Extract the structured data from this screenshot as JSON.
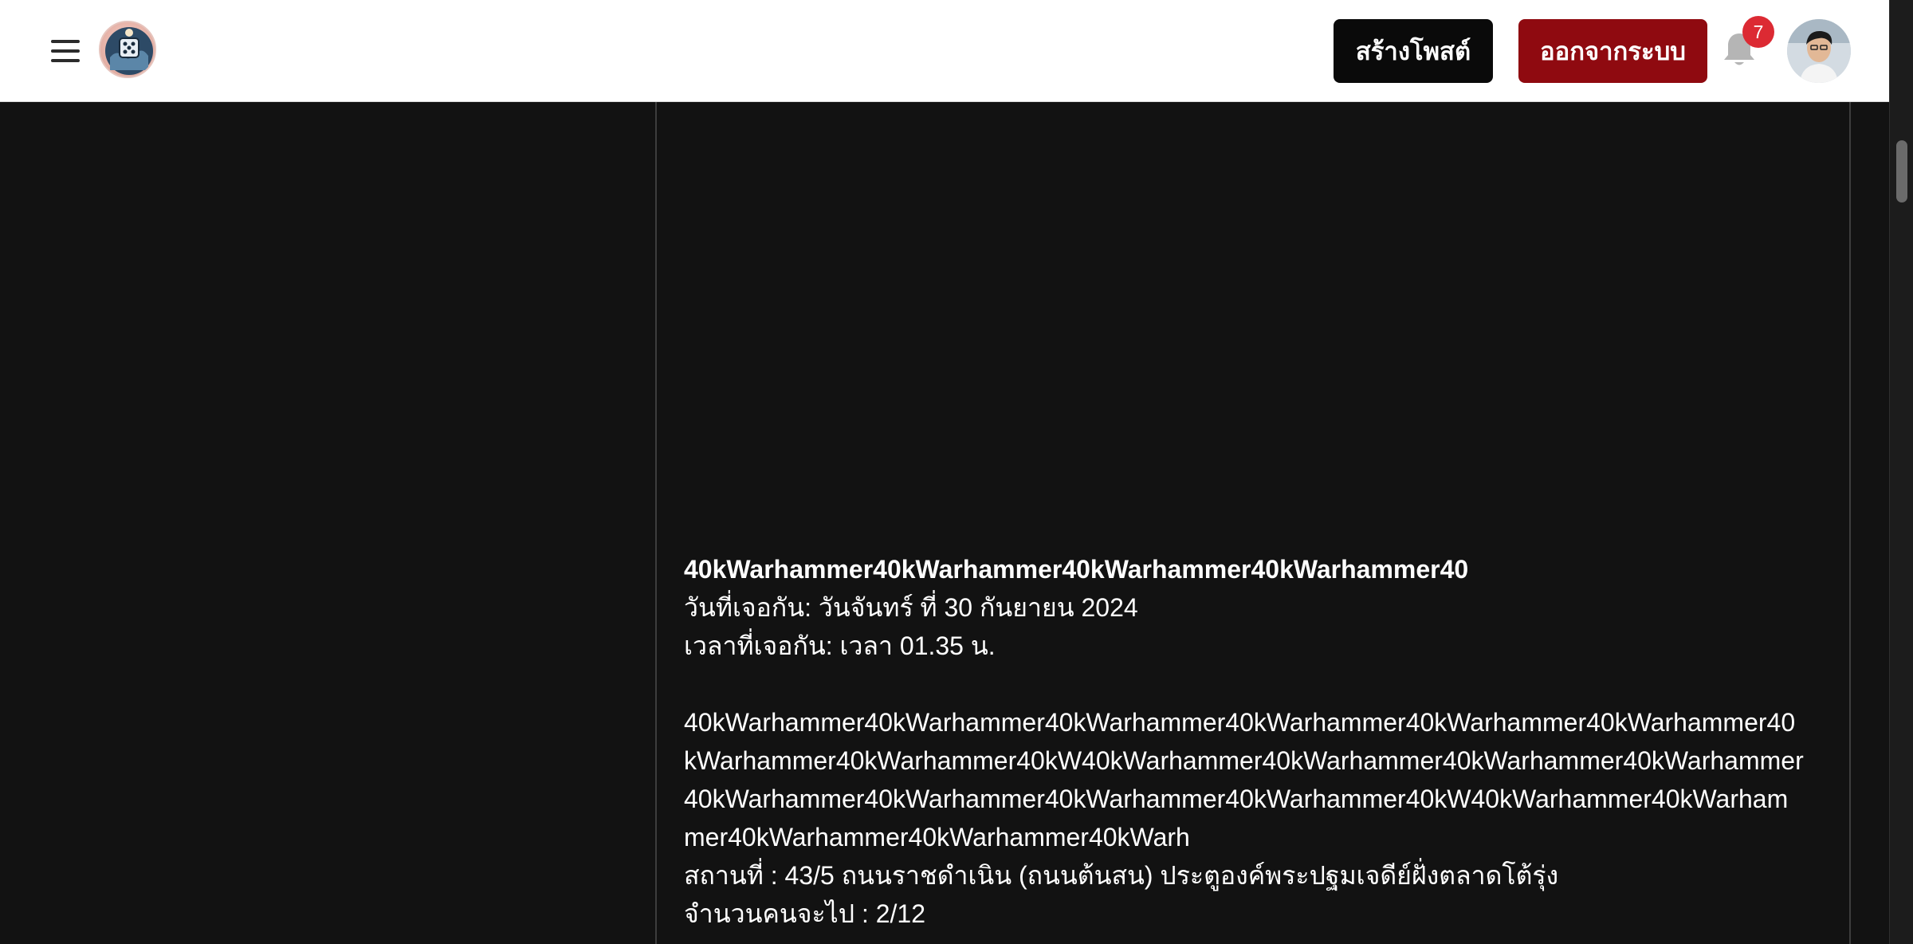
{
  "header": {
    "create_post_label": "สร้างโพสต์",
    "logout_label": "ออกจากระบบ",
    "notification_count": "7"
  },
  "post": {
    "title": "40kWarhammer40kWarhammer40kWarhammer40kWarhammer40",
    "meet_date": "วันที่เจอกัน: วันจันทร์ ที่ 30 กันยายน 2024",
    "meet_time": "เวลาที่เจอกัน: เวลา 01.35 น.",
    "description_lines": [
      "40kWarhammer40kWarhammer40kWarhammer40kWarhammer40kWarhammer40kWarhammer40",
      "kWarhammer40kWarhammer40kW40kWarhammer40kWarhammer40kWarhammer40kWarhammer",
      "40kWarhammer40kWarhammer40kWarhammer40kWarhammer40kW40kWarhammer40kWarham",
      "mer40kWarhammer40kWarhammer40kWarh"
    ],
    "location": "สถานที่ : 43/5 ถนนราชดำเนิน (ถนนต้นสน) ประตูองค์พระปฐมเจดีย์ฝั่งตลาดโต้รุ่ง",
    "attendees": "จำนวนคนจะไป : 2/12"
  },
  "icons": {
    "menu": "hamburger-menu-icon",
    "bell": "bell-icon"
  },
  "colors": {
    "logout_button": "#8f0a10",
    "create_button": "#0a0a0a",
    "badge": "#dc2a33",
    "background": "#121212"
  }
}
